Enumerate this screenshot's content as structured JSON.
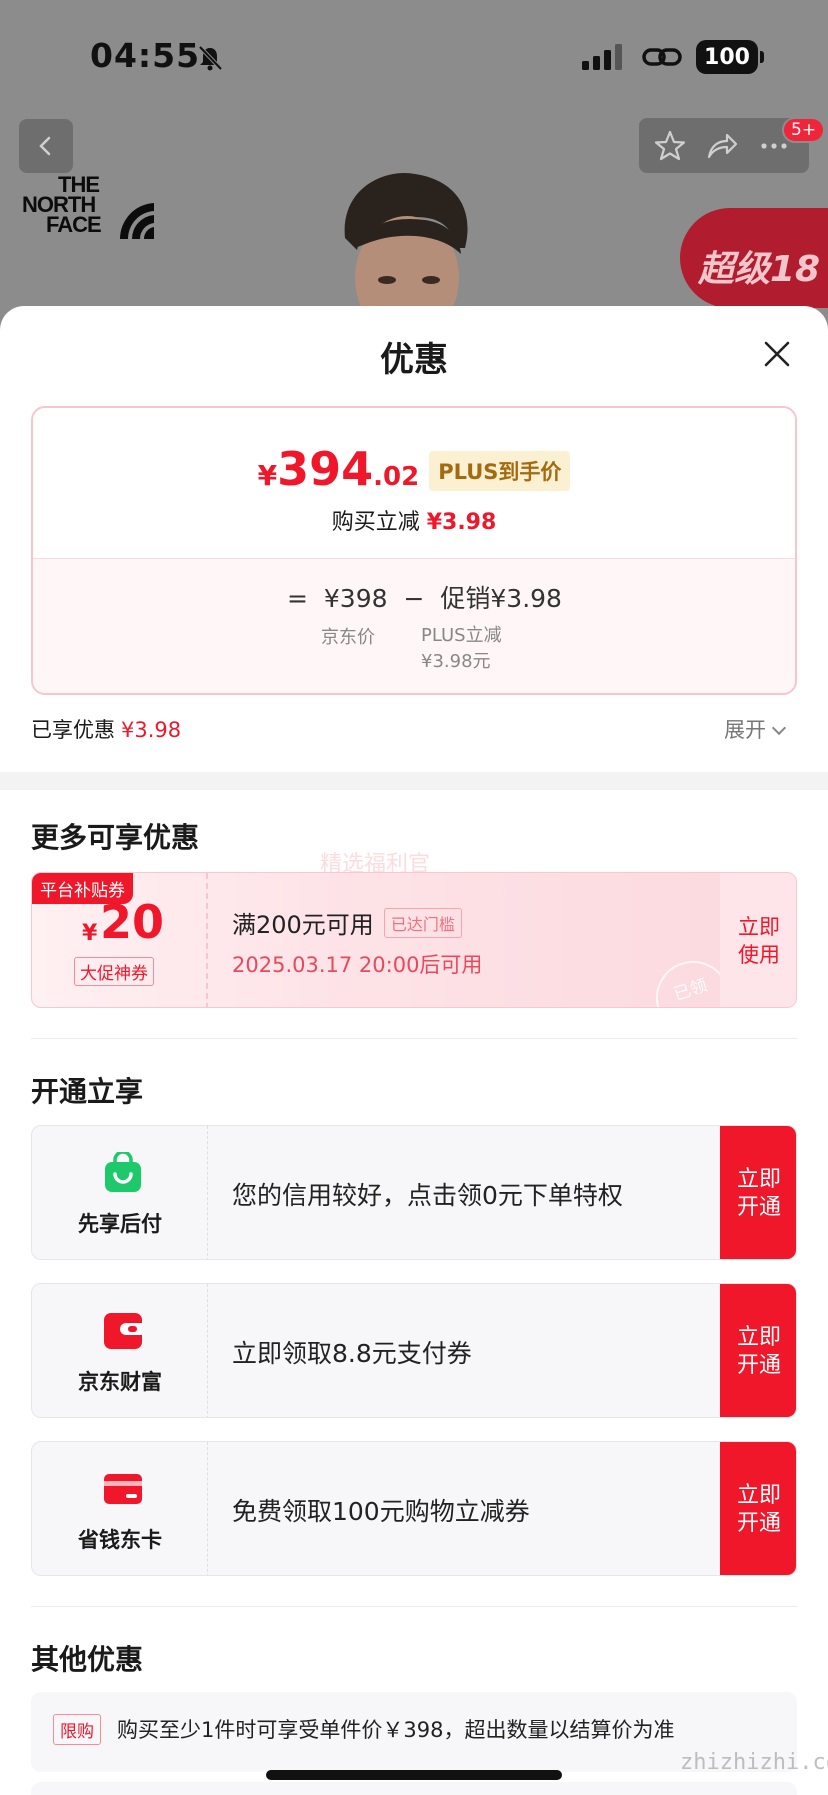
{
  "status_bar": {
    "time": "04:55",
    "battery": "100"
  },
  "background": {
    "brand_logo_lines": [
      "THE",
      "NORTH",
      "FACE"
    ],
    "promo_banner": "超级18",
    "notification_badge": "5+"
  },
  "sheet": {
    "title": "优惠",
    "price_card": {
      "currency": "¥",
      "price_int": "394",
      "price_dec": ".02",
      "plus_tag": "PLUS到手价",
      "reduce_label": "购买立减",
      "reduce_amount": "¥3.98",
      "formula": {
        "eq": "=",
        "jd_price": "¥398",
        "minus": "−",
        "promo": "促销¥3.98",
        "jd_price_label": "京东价",
        "plus_reduce_label_1": "PLUS立减",
        "plus_reduce_label_2": "¥3.98元"
      }
    },
    "enjoyed": {
      "label": "已享优惠",
      "amount": "¥3.98",
      "expand_label": "展开"
    },
    "more_section": {
      "title": "更多可享优惠",
      "watermark": "精选福利官",
      "coupon": {
        "tag": "平台补贴券",
        "currency": "¥",
        "amount": "20",
        "label": "大促神券",
        "condition": "满200元可用",
        "reached": "已达门槛",
        "time": "2025.03.17 20:00后可用",
        "use_button": "立即使用",
        "stamp": "已领"
      }
    },
    "open_section": {
      "title": "开通立享",
      "items": [
        {
          "name": "先享后付",
          "text": "您的信用较好，点击领0元下单特权",
          "button": "立即开通",
          "icon": "shopping-bag-icon",
          "color": "#1ec96b"
        },
        {
          "name": "京东财富",
          "text": "立即领取8.8元支付券",
          "button": "立即开通",
          "icon": "wallet-icon",
          "color": "#f0172b"
        },
        {
          "name": "省钱东卡",
          "text": "免费领取100元购物立减券",
          "button": "立即开通",
          "icon": "card-icon",
          "color": "#f0172b"
        }
      ]
    },
    "other_section": {
      "title": "其他优惠",
      "row1_tag": "限购",
      "row1_text": "购买至少1件时可享受单件价￥398，超出数量以结算价为准"
    }
  },
  "site_watermark": "zhizhizhi.com",
  "colors": {
    "accent": "#f0172b",
    "plus_gold": "#a36a10"
  }
}
